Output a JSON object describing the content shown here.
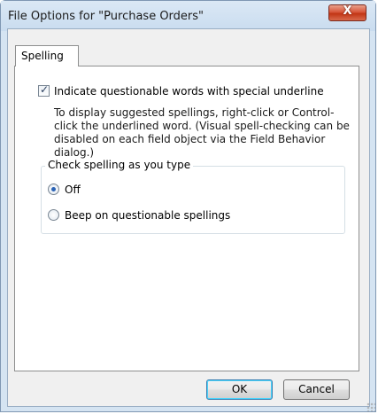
{
  "window": {
    "title": "File Options for \"Purchase Orders\"",
    "close_glyph": "X"
  },
  "tabs": [
    {
      "label": "Spelling",
      "active": true
    }
  ],
  "spelling": {
    "underline_checkbox_label": "Indicate questionable words with special underline",
    "underline_checked": true,
    "hint_text": "To display suggested spellings, right-click or Control-click the underlined word. (Visual spell-checking can be disabled on each field object via the Field Behavior dialog.)",
    "group_label": "Check spelling as you type",
    "options": [
      {
        "label": "Off",
        "selected": true
      },
      {
        "label": "Beep on questionable spellings",
        "selected": false
      }
    ]
  },
  "buttons": {
    "ok_label": "OK",
    "cancel_label": "Cancel"
  },
  "icons": {
    "close": "close-icon",
    "checkbox": "checkbox-checked-icon",
    "radio_on": "radio-selected-icon",
    "radio_off": "radio-unselected-icon",
    "grip": "resize-grip-icon"
  },
  "colors": {
    "title_bar": "#c9dcef",
    "close_button": "#c23515",
    "dialog_bg": "#f0f0f0",
    "panel_bg": "#ffffff",
    "default_button_border": "#3c7fb1",
    "radio_dot": "#2b63b5"
  }
}
